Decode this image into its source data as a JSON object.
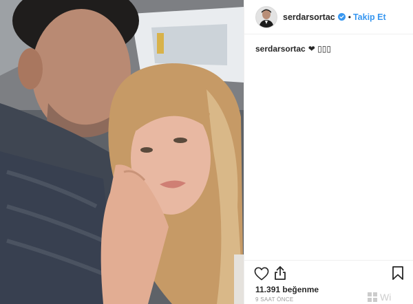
{
  "post": {
    "username": "serdarsortac",
    "follow_label": "Takip Et",
    "separator": "•",
    "caption": {
      "username": "serdarsortac",
      "text": "❤ ▯▯▯"
    },
    "likes_text": "11.391 beğenme",
    "timestamp": "9 SAAT ÖNCE"
  },
  "watermark": {
    "text": "Wi"
  },
  "colors": {
    "link_blue": "#3897f0",
    "text_dark": "#262626",
    "muted": "#999999",
    "verified_blue": "#3897f0",
    "border": "#efefef"
  },
  "icons": {
    "verified": "verified-badge-icon",
    "like": "heart-icon",
    "share": "share-icon",
    "save": "bookmark-icon"
  }
}
